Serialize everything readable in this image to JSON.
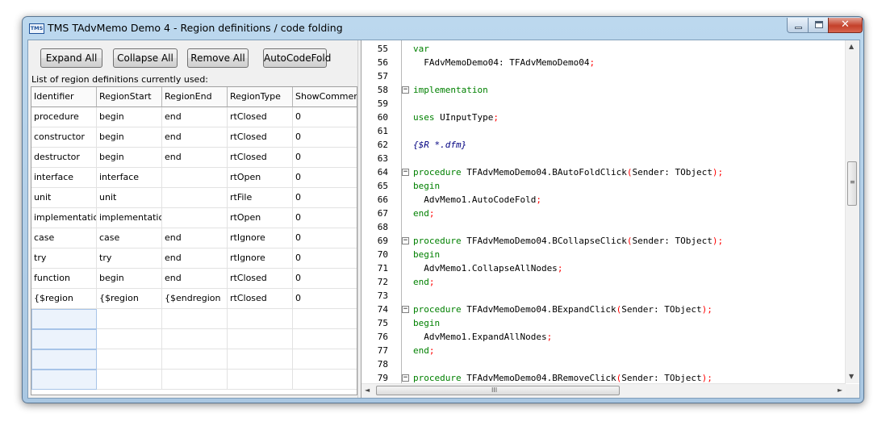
{
  "window": {
    "title": "TMS TAdvMemo Demo 4 - Region definitions / code folding",
    "icon_text": "TMS",
    "close_glyph": "✕"
  },
  "toolbar": {
    "expand_all": "Expand All",
    "collapse_all": "Collapse All",
    "remove_all": "Remove All",
    "auto_code_fold": "AutoCodeFold"
  },
  "list_label": "List of region definitions currently used:",
  "grid": {
    "columns": [
      "Identifier",
      "RegionStart",
      "RegionEnd",
      "RegionType",
      "ShowComments"
    ],
    "rows": [
      [
        "procedure",
        "begin",
        "end",
        "rtClosed",
        "0"
      ],
      [
        "constructor",
        "begin",
        "end",
        "rtClosed",
        "0"
      ],
      [
        "destructor",
        "begin",
        "end",
        "rtClosed",
        "0"
      ],
      [
        "interface",
        "interface",
        "",
        "rtOpen",
        "0"
      ],
      [
        "unit",
        "unit",
        "",
        "rtFile",
        "0"
      ],
      [
        "implementation",
        "implementation",
        "",
        "rtOpen",
        "0"
      ],
      [
        "case",
        "case",
        "end",
        "rtIgnore",
        "0"
      ],
      [
        "try",
        "try",
        "end",
        "rtIgnore",
        "0"
      ],
      [
        "function",
        "begin",
        "end",
        "rtClosed",
        "0"
      ],
      [
        "{$region",
        "{$region",
        "{$endregion",
        "rtClosed",
        "0"
      ]
    ]
  },
  "editor": {
    "lines": [
      {
        "n": "55",
        "fold": "",
        "parts": [
          [
            "kw",
            "var"
          ]
        ]
      },
      {
        "n": "56",
        "fold": "",
        "parts": [
          [
            "id",
            "  FAdvMemoDemo04: TFAdvMemoDemo04"
          ],
          [
            "sym",
            ";"
          ]
        ]
      },
      {
        "n": "57",
        "fold": "",
        "parts": []
      },
      {
        "n": "58",
        "fold": "−",
        "parts": [
          [
            "kw",
            "implementation"
          ]
        ]
      },
      {
        "n": "59",
        "fold": "",
        "parts": []
      },
      {
        "n": "60",
        "fold": "",
        "parts": [
          [
            "kw",
            "uses"
          ],
          [
            "id",
            " UInputType"
          ],
          [
            "sym",
            ";"
          ]
        ]
      },
      {
        "n": "61",
        "fold": "",
        "parts": []
      },
      {
        "n": "62",
        "fold": "",
        "parts": [
          [
            "cm",
            "{$R *.dfm}"
          ]
        ]
      },
      {
        "n": "63",
        "fold": "",
        "parts": []
      },
      {
        "n": "64",
        "fold": "−",
        "parts": [
          [
            "kw",
            "procedure"
          ],
          [
            "id",
            " TFAdvMemoDemo04.BAutoFoldClick"
          ],
          [
            "sym",
            "("
          ],
          [
            "id",
            "Sender: TObject"
          ],
          [
            "sym",
            ");"
          ]
        ]
      },
      {
        "n": "65",
        "fold": "",
        "parts": [
          [
            "kw",
            "begin"
          ]
        ]
      },
      {
        "n": "66",
        "fold": "",
        "parts": [
          [
            "id",
            "  AdvMemo1.AutoCodeFold"
          ],
          [
            "sym",
            ";"
          ]
        ]
      },
      {
        "n": "67",
        "fold": "",
        "parts": [
          [
            "kw",
            "end"
          ],
          [
            "sym",
            ";"
          ]
        ]
      },
      {
        "n": "68",
        "fold": "",
        "parts": []
      },
      {
        "n": "69",
        "fold": "−",
        "parts": [
          [
            "kw",
            "procedure"
          ],
          [
            "id",
            " TFAdvMemoDemo04.BCollapseClick"
          ],
          [
            "sym",
            "("
          ],
          [
            "id",
            "Sender: TObject"
          ],
          [
            "sym",
            ");"
          ]
        ]
      },
      {
        "n": "70",
        "fold": "",
        "parts": [
          [
            "kw",
            "begin"
          ]
        ]
      },
      {
        "n": "71",
        "fold": "",
        "parts": [
          [
            "id",
            "  AdvMemo1.CollapseAllNodes"
          ],
          [
            "sym",
            ";"
          ]
        ]
      },
      {
        "n": "72",
        "fold": "",
        "parts": [
          [
            "kw",
            "end"
          ],
          [
            "sym",
            ";"
          ]
        ]
      },
      {
        "n": "73",
        "fold": "",
        "parts": []
      },
      {
        "n": "74",
        "fold": "−",
        "parts": [
          [
            "kw",
            "procedure"
          ],
          [
            "id",
            " TFAdvMemoDemo04.BExpandClick"
          ],
          [
            "sym",
            "("
          ],
          [
            "id",
            "Sender: TObject"
          ],
          [
            "sym",
            ");"
          ]
        ]
      },
      {
        "n": "75",
        "fold": "",
        "parts": [
          [
            "kw",
            "begin"
          ]
        ]
      },
      {
        "n": "76",
        "fold": "",
        "parts": [
          [
            "id",
            "  AdvMemo1.ExpandAllNodes"
          ],
          [
            "sym",
            ";"
          ]
        ]
      },
      {
        "n": "77",
        "fold": "",
        "parts": [
          [
            "kw",
            "end"
          ],
          [
            "sym",
            ";"
          ]
        ]
      },
      {
        "n": "78",
        "fold": "",
        "parts": []
      },
      {
        "n": "79",
        "fold": "−",
        "parts": [
          [
            "kw",
            "procedure"
          ],
          [
            "id",
            " TFAdvMemoDemo04.BRemoveClick"
          ],
          [
            "sym",
            "("
          ],
          [
            "id",
            "Sender: TObject"
          ],
          [
            "sym",
            ");"
          ]
        ]
      }
    ]
  },
  "icons": {
    "up": "▲",
    "down": "▼",
    "left": "◄",
    "right": "►",
    "vgrip": "≡",
    "hgrip": "III"
  }
}
